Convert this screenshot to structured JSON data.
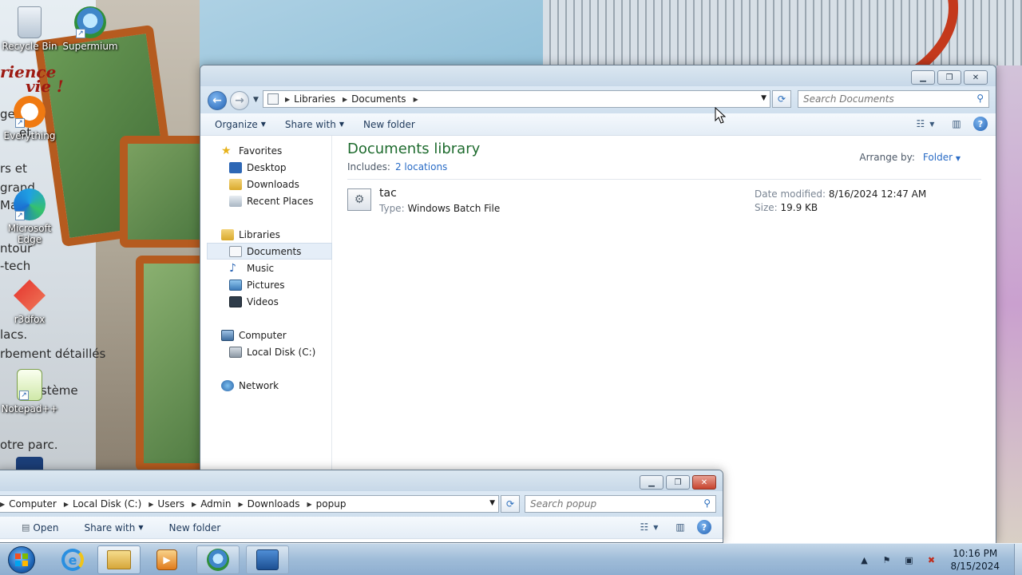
{
  "desktop": {
    "wallpaper_text": {
      "line1": "",
      "line2": "rience",
      "line3": "vie !",
      "fragments": [
        "ges",
        "et",
        "rs et",
        "grand",
        "Ma",
        "ntour",
        "-tech",
        "lacs.",
        "rbement détaillés",
        "ystème",
        "otre parc."
      ]
    },
    "icons": [
      {
        "name": "recycle-bin",
        "label": "Recycle Bin"
      },
      {
        "name": "supermium",
        "label": "Supermium"
      },
      {
        "name": "everything",
        "label": "Everything"
      },
      {
        "name": "microsoft-edge",
        "label": "Microsoft Edge"
      },
      {
        "name": "r3dfox",
        "label": "r3dfox"
      },
      {
        "name": "notepad-plus-plus",
        "label": "Notepad++"
      }
    ]
  },
  "main_window": {
    "breadcrumb": [
      "Libraries",
      "Documents"
    ],
    "search_placeholder": "Search Documents",
    "toolbar": {
      "organize": "Organize",
      "share_with": "Share with",
      "new_folder": "New folder"
    },
    "nav": {
      "favorites": "Favorites",
      "desktop": "Desktop",
      "downloads": "Downloads",
      "recent_places": "Recent Places",
      "libraries": "Libraries",
      "documents": "Documents",
      "music": "Music",
      "pictures": "Pictures",
      "videos": "Videos",
      "computer": "Computer",
      "local_disk": "Local Disk (C:)",
      "network": "Network"
    },
    "library": {
      "title": "Documents library",
      "includes_label": "Includes:",
      "includes_link": "2 locations",
      "arrange_label": "Arrange by:",
      "arrange_value": "Folder"
    },
    "file": {
      "name": "tac",
      "type_label": "Type:",
      "type_value": "Windows Batch File",
      "date_label": "Date modified:",
      "date_value": "8/16/2024 12:47 AM",
      "size_label": "Size:",
      "size_value": "19.9 KB"
    }
  },
  "second_window": {
    "breadcrumb": [
      "Computer",
      "Local Disk (C:)",
      "Users",
      "Admin",
      "Downloads",
      "popup"
    ],
    "search_placeholder": "Search popup",
    "toolbar": {
      "open": "Open",
      "share_with": "Share with",
      "new_folder": "New folder"
    }
  },
  "taskbar": {
    "time": "10:16 PM",
    "date": "8/15/2024"
  },
  "colors": {
    "library_title": "#1e6b2e",
    "link": "#2a6cc6",
    "close_button": "#c7432e"
  }
}
